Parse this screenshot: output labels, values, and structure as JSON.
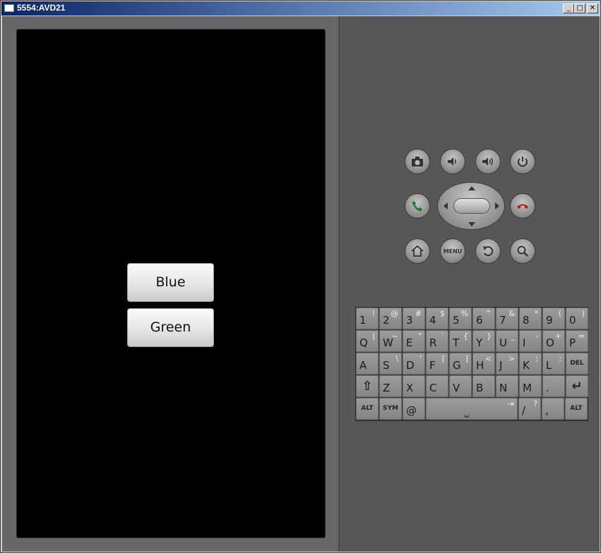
{
  "window": {
    "title": "5554:AVD21",
    "minimize": "_",
    "maximize": "□",
    "close": "✕"
  },
  "app": {
    "buttons": [
      "Blue",
      "Green"
    ]
  },
  "controls": {
    "menu_label": "MENU"
  },
  "keyboard": {
    "rows": [
      [
        {
          "m": "1",
          "s": "!"
        },
        {
          "m": "2",
          "s": "@"
        },
        {
          "m": "3",
          "s": "#"
        },
        {
          "m": "4",
          "s": "$"
        },
        {
          "m": "5",
          "s": "%"
        },
        {
          "m": "6",
          "s": "^"
        },
        {
          "m": "7",
          "s": "&"
        },
        {
          "m": "8",
          "s": "*"
        },
        {
          "m": "9",
          "s": "("
        },
        {
          "m": "0",
          "s": ")"
        }
      ],
      [
        {
          "m": "Q",
          "s": "|"
        },
        {
          "m": "W",
          "s": "~"
        },
        {
          "m": "E",
          "s": "\""
        },
        {
          "m": "R",
          "s": "`"
        },
        {
          "m": "T",
          "s": "{"
        },
        {
          "m": "Y",
          "s": "}"
        },
        {
          "m": "U",
          "s": "_"
        },
        {
          "m": "I",
          "s": "-"
        },
        {
          "m": "O",
          "s": "+"
        },
        {
          "m": "P",
          "s": "="
        }
      ],
      [
        {
          "m": "A",
          "s": ""
        },
        {
          "m": "S",
          "s": "\\"
        },
        {
          "m": "D",
          "s": "'"
        },
        {
          "m": "F",
          "s": "["
        },
        {
          "m": "G",
          "s": "]"
        },
        {
          "m": "H",
          "s": "<"
        },
        {
          "m": "J",
          "s": ">"
        },
        {
          "m": "K",
          "s": ";"
        },
        {
          "m": "L",
          "s": ":"
        },
        {
          "m": "",
          "s": "",
          "c": "DEL"
        }
      ],
      [
        {
          "m": "",
          "s": "",
          "c": "⇧"
        },
        {
          "m": "Z",
          "s": ""
        },
        {
          "m": "X",
          "s": ""
        },
        {
          "m": "C",
          "s": ""
        },
        {
          "m": "V",
          "s": ""
        },
        {
          "m": "B",
          "s": ""
        },
        {
          "m": "N",
          "s": ""
        },
        {
          "m": "M",
          "s": ""
        },
        {
          "m": ".",
          "s": ""
        },
        {
          "m": "",
          "s": "",
          "c": "↵"
        }
      ]
    ],
    "bottom": {
      "alt_left": "ALT",
      "sym": "SYM",
      "at": "@",
      "space": "⎵",
      "tab": "⇥",
      "slash": "/",
      "question": "?",
      "comma": ",",
      "alt_right": "ALT"
    }
  }
}
